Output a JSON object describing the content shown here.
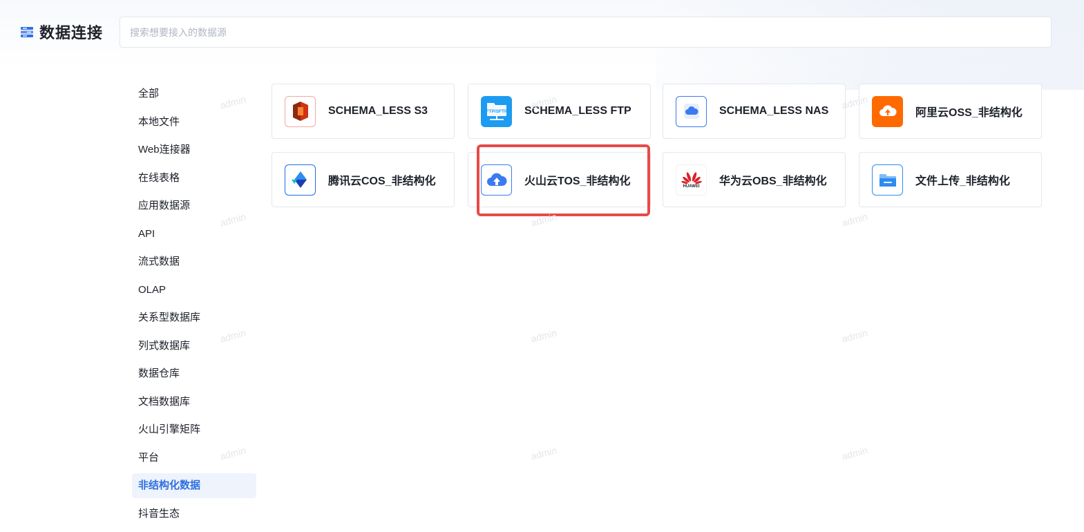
{
  "header": {
    "title": "数据连接",
    "search_placeholder": "搜索想要接入的数据源",
    "search_value": ""
  },
  "sidebar": {
    "items": [
      {
        "label": "全部",
        "active": false
      },
      {
        "label": "本地文件",
        "active": false
      },
      {
        "label": "Web连接器",
        "active": false
      },
      {
        "label": "在线表格",
        "active": false
      },
      {
        "label": "应用数据源",
        "active": false
      },
      {
        "label": "API",
        "active": false
      },
      {
        "label": "流式数据",
        "active": false
      },
      {
        "label": "OLAP",
        "active": false
      },
      {
        "label": "关系型数据库",
        "active": false
      },
      {
        "label": "列式数据库",
        "active": false
      },
      {
        "label": "数据仓库",
        "active": false
      },
      {
        "label": "文档数据库",
        "active": false
      },
      {
        "label": "火山引擎矩阵",
        "active": false
      },
      {
        "label": "平台",
        "active": false
      },
      {
        "label": "非结构化数据",
        "active": true
      },
      {
        "label": "抖音生态",
        "active": false
      }
    ]
  },
  "connectors": [
    {
      "label": "SCHEMA_LESS S3",
      "icon": "aws-s3-icon",
      "color": "#d13212"
    },
    {
      "label": "SCHEMA_LESS FTP",
      "icon": "ftp-folder-icon",
      "color": "#1d9bf0",
      "icon_text": "FTP/SFTP"
    },
    {
      "label": "SCHEMA_LESS NAS",
      "icon": "nas-cloud-icon",
      "color": "#3a7af2"
    },
    {
      "label": "阿里云OSS_非结构化",
      "icon": "aliyun-oss-icon",
      "color": "#ff6a00"
    },
    {
      "label": "腾讯云COS_非结构化",
      "icon": "tencent-cos-icon",
      "color": "#1e6ee8"
    },
    {
      "label": "火山云TOS_非结构化",
      "icon": "volcano-tos-icon",
      "color": "#3a7af2",
      "highlighted": true
    },
    {
      "label": "华为云OBS_非结构化",
      "icon": "huawei-obs-icon",
      "color": "#d8222a",
      "icon_text": "HUAWEI"
    },
    {
      "label": "文件上传_非结构化",
      "icon": "file-upload-folder-icon",
      "color": "#2d8cf0"
    }
  ],
  "watermark": "admin",
  "colors": {
    "accent": "#2f6fe0",
    "highlight_box": "#e84a48",
    "border": "#e3e6eb"
  }
}
